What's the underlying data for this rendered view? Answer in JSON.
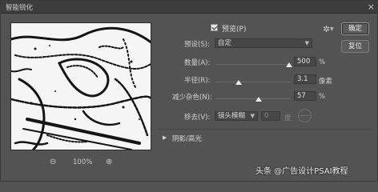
{
  "window": {
    "title": "智能锐化",
    "close_glyph": "×"
  },
  "preview": {
    "zoom_out_glyph": "⊖",
    "zoom_level": "100%",
    "zoom_in_glyph": "⊕"
  },
  "preview_toggle": {
    "label": "预览(P)",
    "checked": true
  },
  "buttons": {
    "ok": "确定",
    "reset": "复位"
  },
  "gear": {
    "glyph": "✲",
    "caret": "▼"
  },
  "preset": {
    "label": "预设(S):",
    "value": "自定"
  },
  "amount": {
    "label": "数量(A):",
    "value": "500",
    "unit": "%",
    "level": 0.98
  },
  "radius": {
    "label": "半径(R):",
    "value": "3.1",
    "unit": "像素",
    "level": 0.31
  },
  "reduce_noise": {
    "label": "减少杂色(N):",
    "value": "57",
    "unit": "%",
    "level": 0.57
  },
  "remove": {
    "label": "移去(V):",
    "value": "镜头模糊",
    "angle": "0",
    "angle_unit": "度"
  },
  "section": {
    "caret": "▶",
    "label": "阴影/高光"
  },
  "watermark": "头条 @广告设计PSAI教程",
  "colors": {
    "dialog_bg": "#535353",
    "titlebar_bg": "#3d3d3d",
    "input_bg": "#464646",
    "thumb": "#e9e9e9"
  }
}
